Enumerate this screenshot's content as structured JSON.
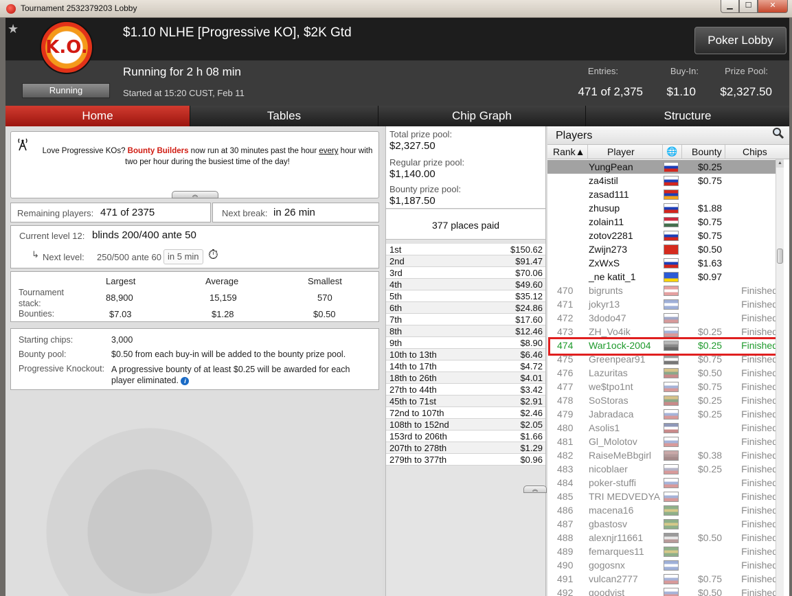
{
  "window": {
    "title": "Tournament 2532379203 Lobby",
    "min_glyph": "▁",
    "max_glyph": "☐",
    "close_glyph": "✕"
  },
  "header": {
    "star_glyph": "★",
    "logo_text": "K.O.",
    "status": "Running",
    "tournament_name": "$1.10 NLHE [Progressive KO], $2K Gtd",
    "running_for": "Running for 2 h 08 min",
    "started_at": "Started at 15:20 CUST, Feb 11",
    "poker_lobby_label": "Poker Lobby",
    "entries_label": "Entries:",
    "entries_value": "471 of 2,375",
    "buyin_label": "Buy-In:",
    "buyin_value": "$1.10",
    "prizepool_label": "Prize Pool:",
    "prizepool_value": "$2,327.50"
  },
  "tabs": [
    "Home",
    "Tables",
    "Chip Graph",
    "Structure"
  ],
  "news": {
    "icon": "broadcast-tower-icon",
    "before": "Love Progressive KOs? ",
    "highlight": "Bounty Builders",
    "middle": " now run at 30 minutes past the hour ",
    "underline": "every",
    "after": " hour with two per hour during the busiest time of the day!",
    "collapse_glyph": "︽"
  },
  "remaining": {
    "label": "Remaining players:",
    "value": "471 of 2375"
  },
  "next_break": {
    "label": "Next break:",
    "value": "in 26 min"
  },
  "level": {
    "current_label": "Current level 12:",
    "current_value": "blinds 200/400 ante 50",
    "next_arrow": "↳",
    "next_label": "Next level:",
    "next_value": "250/500 ante 60",
    "next_in": "in 5 min",
    "timer_glyph": "⏱"
  },
  "stack_table": {
    "headers": [
      "Largest",
      "Average",
      "Smallest"
    ],
    "stack_label": "Tournament stack:",
    "stack_values": [
      "88,900",
      "15,159",
      "570"
    ],
    "bounties_label": "Bounties:",
    "bounty_values": [
      "$7.03",
      "$1.28",
      "$0.50"
    ]
  },
  "info": {
    "starting_label": "Starting chips:",
    "starting_value": "3,000",
    "bountypool_label": "Bounty pool:",
    "bountypool_value": "$0.50 from each buy-in will be added to the bounty prize pool.",
    "pko_label": "Progressive Knockout:",
    "pko_value": "A progressive bounty of at least $0.25 will be awarded for each player eliminated.",
    "info_glyph": "i"
  },
  "prize": {
    "total_label": "Total prize pool:",
    "total_value": "$2,327.50",
    "regular_label": "Regular prize pool:",
    "regular_value": "$1,140.00",
    "bounty_label": "Bounty prize pool:",
    "bounty_value": "$1,187.50",
    "places_paid": "377 places paid",
    "payouts": [
      [
        "1st",
        "$150.62"
      ],
      [
        "2nd",
        "$91.47"
      ],
      [
        "3rd",
        "$70.06"
      ],
      [
        "4th",
        "$49.60"
      ],
      [
        "5th",
        "$35.12"
      ],
      [
        "6th",
        "$24.86"
      ],
      [
        "7th",
        "$17.60"
      ],
      [
        "8th",
        "$12.46"
      ],
      [
        "9th",
        "$8.90"
      ],
      [
        "10th to 13th",
        "$6.46"
      ],
      [
        "14th to 17th",
        "$4.72"
      ],
      [
        "18th to 26th",
        "$4.01"
      ],
      [
        "27th to 44th",
        "$3.42"
      ],
      [
        "45th to 71st",
        "$2.91"
      ],
      [
        "72nd to 107th",
        "$2.46"
      ],
      [
        "108th to 152nd",
        "$2.05"
      ],
      [
        "153rd to 206th",
        "$1.66"
      ],
      [
        "207th to 278th",
        "$1.29"
      ],
      [
        "279th to 377th",
        "$0.96"
      ]
    ]
  },
  "players": {
    "title": "Players",
    "search_icon": "magnifier-icon",
    "search_glyph": "🔍",
    "col_rank": "Rank▲",
    "col_player": "Player",
    "col_globe": "🌐",
    "col_bounty": "Bounty",
    "col_chips": "Chips",
    "rows": [
      {
        "rank": "",
        "name": "YungPean",
        "flag": [
          "#ffffff",
          "#1c3fb8",
          "#d3261d"
        ],
        "bounty": "$0.25",
        "chips": "",
        "state": "sel"
      },
      {
        "rank": "",
        "name": "za4istil",
        "flag": [
          "#ffffff",
          "#1c3fb8",
          "#d3261d"
        ],
        "bounty": "$0.75",
        "chips": "",
        "state": ""
      },
      {
        "rank": "",
        "name": "zasad111",
        "flag": [
          "#d3261d",
          "#1c3fb8",
          "#f0a21c"
        ],
        "bounty": "",
        "chips": "",
        "state": ""
      },
      {
        "rank": "",
        "name": "zhusup",
        "flag": [
          "#ffffff",
          "#1c3fb8",
          "#d3261d"
        ],
        "bounty": "$1.88",
        "chips": "",
        "state": ""
      },
      {
        "rank": "",
        "name": "zolain11",
        "flag": [
          "#cd2a3e",
          "#ffffff",
          "#436f4d"
        ],
        "bounty": "$0.75",
        "chips": "",
        "state": ""
      },
      {
        "rank": "",
        "name": "zotov2281",
        "flag": [
          "#ffffff",
          "#1c3fb8",
          "#d3261d"
        ],
        "bounty": "$0.75",
        "chips": "",
        "state": ""
      },
      {
        "rank": "",
        "name": "Zwijn273",
        "flag": [
          "#d52b1e",
          "#d52b1e",
          "#d52b1e"
        ],
        "bounty": "$0.50",
        "chips": "",
        "state": ""
      },
      {
        "rank": "",
        "name": "ZxWxS",
        "flag": [
          "#ffffff",
          "#1c3fb8",
          "#d3261d"
        ],
        "bounty": "$1.63",
        "chips": "",
        "state": ""
      },
      {
        "rank": "",
        "name": "_ne katit_1",
        "flag": [
          "#2c5bd6",
          "#2c5bd6",
          "#ffd500"
        ],
        "bounty": "$0.97",
        "chips": "",
        "state": ""
      },
      {
        "rank": "470",
        "name": "bigrunts",
        "flag": [
          "#e4a0a0",
          "#ffffff",
          "#e4a0a0"
        ],
        "bounty": "",
        "chips": "Finished",
        "state": "fin"
      },
      {
        "rank": "471",
        "name": "jokyr13",
        "flag": [
          "#9fb0d8",
          "#ffffff",
          "#9fb0d8"
        ],
        "bounty": "",
        "chips": "Finished",
        "state": "fin"
      },
      {
        "rank": "472",
        "name": "3dodo47",
        "flag": [
          "#ffffff",
          "#a0a8c8",
          "#d79a9a"
        ],
        "bounty": "",
        "chips": "Finished",
        "state": "fin"
      },
      {
        "rank": "473",
        "name": "ZH_Vo4ik",
        "flag": [
          "#ffffff",
          "#a6b3d8",
          "#d89a9a"
        ],
        "bounty": "$0.25",
        "chips": "Finished",
        "state": "fin"
      },
      {
        "rank": "474",
        "name": "War1ock-2004",
        "flag": [
          "#b8b8b8",
          "#8a8a8a",
          "#6a6a6a"
        ],
        "bounty": "$0.25",
        "chips": "Finished",
        "state": "hi"
      },
      {
        "rank": "475",
        "name": "Greenpear91",
        "flag": [
          "#9a9a9a",
          "#ffffff",
          "#777777"
        ],
        "bounty": "$0.75",
        "chips": "Finished",
        "state": "fin"
      },
      {
        "rank": "476",
        "name": "Lazuritas",
        "flag": [
          "#d6c28a",
          "#8ba88a",
          "#c98a8a"
        ],
        "bounty": "$0.50",
        "chips": "Finished",
        "state": "fin"
      },
      {
        "rank": "477",
        "name": "we$tpo1nt",
        "flag": [
          "#ffffff",
          "#a6b3d8",
          "#d89a9a"
        ],
        "bounty": "$0.75",
        "chips": "Finished",
        "state": "fin"
      },
      {
        "rank": "478",
        "name": "SoStoras",
        "flag": [
          "#d6c28a",
          "#8ba88a",
          "#c98a8a"
        ],
        "bounty": "$0.25",
        "chips": "Finished",
        "state": "fin"
      },
      {
        "rank": "479",
        "name": "Jabradaca",
        "flag": [
          "#ffffff",
          "#a6b3d8",
          "#d89a9a"
        ],
        "bounty": "$0.25",
        "chips": "Finished",
        "state": "fin"
      },
      {
        "rank": "480",
        "name": "Asolis1",
        "flag": [
          "#8f98b8",
          "#ffffff",
          "#c98a8a"
        ],
        "bounty": "",
        "chips": "Finished",
        "state": "fin"
      },
      {
        "rank": "481",
        "name": "Gl_Molotov",
        "flag": [
          "#ffffff",
          "#a6b3d8",
          "#d89a9a"
        ],
        "bounty": "",
        "chips": "Finished",
        "state": "fin"
      },
      {
        "rank": "482",
        "name": "RaiseMeBbgirl",
        "flag": [
          "#c9a9a9",
          "#b39a9a",
          "#a58a8a"
        ],
        "bounty": "$0.38",
        "chips": "Finished",
        "state": "fin"
      },
      {
        "rank": "483",
        "name": "nicoblaer",
        "flag": [
          "#ffffff",
          "#b5b5c8",
          "#d89a9a"
        ],
        "bounty": "$0.25",
        "chips": "Finished",
        "state": "fin"
      },
      {
        "rank": "484",
        "name": "poker-stuffi",
        "flag": [
          "#ffffff",
          "#a6b3d8",
          "#d89a9a"
        ],
        "bounty": "",
        "chips": "Finished",
        "state": "fin"
      },
      {
        "rank": "485",
        "name": "TRI MEDVEDYA",
        "flag": [
          "#ffffff",
          "#a6b3d8",
          "#d89a9a"
        ],
        "bounty": "",
        "chips": "Finished",
        "state": "fin"
      },
      {
        "rank": "486",
        "name": "macena16",
        "flag": [
          "#8fb08a",
          "#d6c98a",
          "#8fb08a"
        ],
        "bounty": "",
        "chips": "Finished",
        "state": "fin"
      },
      {
        "rank": "487",
        "name": "gbastosv",
        "flag": [
          "#8fb08a",
          "#d6c98a",
          "#8fb08a"
        ],
        "bounty": "",
        "chips": "Finished",
        "state": "fin"
      },
      {
        "rank": "488",
        "name": "alexnjr11661",
        "flag": [
          "#9a9a9a",
          "#e8e8e8",
          "#b89a9a"
        ],
        "bounty": "$0.50",
        "chips": "Finished",
        "state": "fin"
      },
      {
        "rank": "489",
        "name": "femarques11",
        "flag": [
          "#8fb08a",
          "#d6c98a",
          "#8fb08a"
        ],
        "bounty": "",
        "chips": "Finished",
        "state": "fin"
      },
      {
        "rank": "490",
        "name": "gogosnx",
        "flag": [
          "#9fb0d8",
          "#ffffff",
          "#9fb0d8"
        ],
        "bounty": "",
        "chips": "Finished",
        "state": "fin"
      },
      {
        "rank": "491",
        "name": "vulcan2777",
        "flag": [
          "#ffffff",
          "#a6b3d8",
          "#d89a9a"
        ],
        "bounty": "$0.75",
        "chips": "Finished",
        "state": "fin"
      },
      {
        "rank": "492",
        "name": "goodvist",
        "flag": [
          "#ffffff",
          "#a6b3d8",
          "#d89a9a"
        ],
        "bounty": "$0.50",
        "chips": "Finished",
        "state": "fin"
      }
    ]
  }
}
